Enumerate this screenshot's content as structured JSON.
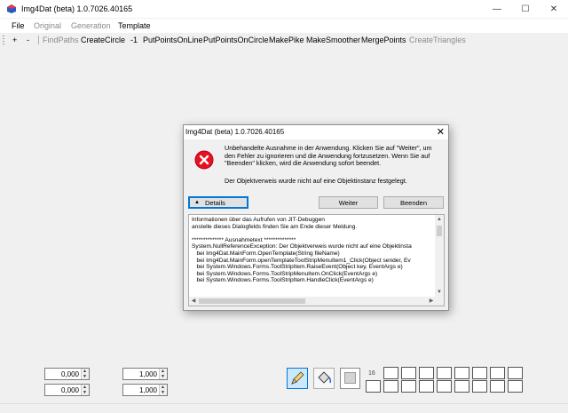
{
  "window": {
    "title": "Img4Dat (beta) 1.0.7026.40165",
    "controls": {
      "minimize": "—",
      "maximize": "☐",
      "close": "✕"
    }
  },
  "menu": {
    "items": [
      {
        "label": "File",
        "enabled": true
      },
      {
        "label": "Original",
        "enabled": false
      },
      {
        "label": "Generation",
        "enabled": false
      },
      {
        "label": "Template",
        "enabled": true
      }
    ]
  },
  "toolbar": {
    "plus": "+",
    "minus": "-",
    "items": [
      {
        "label": "FindPaths",
        "enabled": false
      },
      {
        "label": "CreateCircle",
        "enabled": true
      },
      {
        "label": "-1",
        "enabled": true
      },
      {
        "label": "PutPointsOnLine",
        "enabled": true
      },
      {
        "label": "PutPointsOnCircle",
        "enabled": true
      },
      {
        "label": "MakePike",
        "enabled": true
      },
      {
        "label": "MakeSmoother",
        "enabled": true
      },
      {
        "label": "MergePoints",
        "enabled": true
      },
      {
        "label": "CreateTriangles",
        "enabled": false
      }
    ]
  },
  "dialog": {
    "title": "Img4Dat (beta) 1.0.7026.40165",
    "close": "✕",
    "message": "Unbehandelte Ausnahme in der Anwendung. Klicken Sie auf \"Weiter\", um den Fehler zu ignorieren und die Anwendung fortzusetzen. Wenn Sie auf \"Beenden\" klicken, wird die Anwendung sofort beendet.",
    "message2": "Der Objektverweis wurde nicht auf eine Objektinstanz festgelegt.",
    "details_label": "Details",
    "continue_label": "Weiter",
    "quit_label": "Beenden",
    "details_text": "Informationen über das Aufrufen von JIT-Debuggen\nanstelle dieses Dialogfelds finden Sie am Ende dieser Meldung.\n\n************** Ausnahmetext **************\nSystem.NullReferenceException: Der Objektverweis wurde nicht auf eine Objektinsta\n   bei Img4Dat.MainForm.OpenTemplate(String fileName)\n   bei Img4Dat.MainForm.openTemplateToolStripMenuItem1_Click(Object sender, Ev\n   bei System.Windows.Forms.ToolStripItem.RaiseEvent(Object key, EventArgs e)\n   bei System.Windows.Forms.ToolStripMenuItem.OnClick(EventArgs e)\n   bei System.Windows.Forms.ToolStripItem.HandleClick(EventArgs e)"
  },
  "bottom": {
    "spin1": "0,000",
    "spin2": "0,000",
    "spin3": "1,000",
    "spin4": "1,000",
    "palette_count": "16"
  }
}
